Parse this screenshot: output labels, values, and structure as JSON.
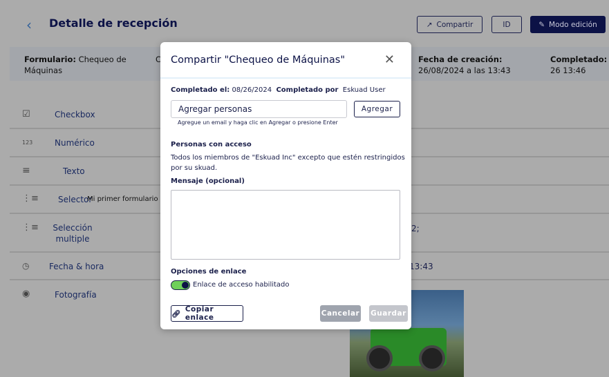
{
  "header": {
    "back_icon": "chevron-left-icon",
    "title": "Detalle de recepción",
    "share_label": "Compartir",
    "id_label": "ID",
    "edit_label": "Modo edición"
  },
  "info": {
    "form_label": "Formulario:",
    "form_value": "Chequeo de Máquinas",
    "c_partial": "C",
    "created_label": "Fecha de creación:",
    "created_value": "26/08/2024 a las 13:43",
    "completed_label": "Completado:",
    "completed_value": "26 13:46"
  },
  "rows": [
    {
      "icon": "checkbox-icon",
      "label": "Checkbox"
    },
    {
      "icon": "numeric-icon",
      "icon_text": "123",
      "label": "Numérico"
    },
    {
      "icon": "text-icon",
      "label": "Texto"
    },
    {
      "icon": "list-icon",
      "label": "Selector",
      "value": "Mi primer formulario"
    },
    {
      "icon": "multi-list-icon",
      "label": "Selección multiple",
      "value": "2;"
    },
    {
      "icon": "datetime-icon",
      "label": "Fecha & hora",
      "value": "13:43"
    },
    {
      "icon": "camera-icon",
      "label": "Fotografía"
    }
  ],
  "modal": {
    "title": "Compartir \"Chequeo de Máquinas\"",
    "completed_on_label": "Completado el:",
    "completed_on_value": "08/26/2024",
    "completed_by_label": "Completado por",
    "completed_by_value": "Eskuad User",
    "add_placeholder": "Agregar personas",
    "add_button": "Agregar",
    "hint": "Agregue un email y haga clic en Agregar o presione Enter",
    "access_heading": "Personas con acceso",
    "access_text": "Todos los miembros de \"Eskuad Inc\" excepto que estén restringidos por su skuad.",
    "message_label": "Mensaje (opcional)",
    "message_value": "",
    "link_options_heading": "Opciones de enlace",
    "toggle_label": "Enlace de acceso habilitado",
    "toggle_on": true,
    "copy_link": "Copiar enlace",
    "cancel": "Cancelar",
    "save": "Guardar"
  }
}
